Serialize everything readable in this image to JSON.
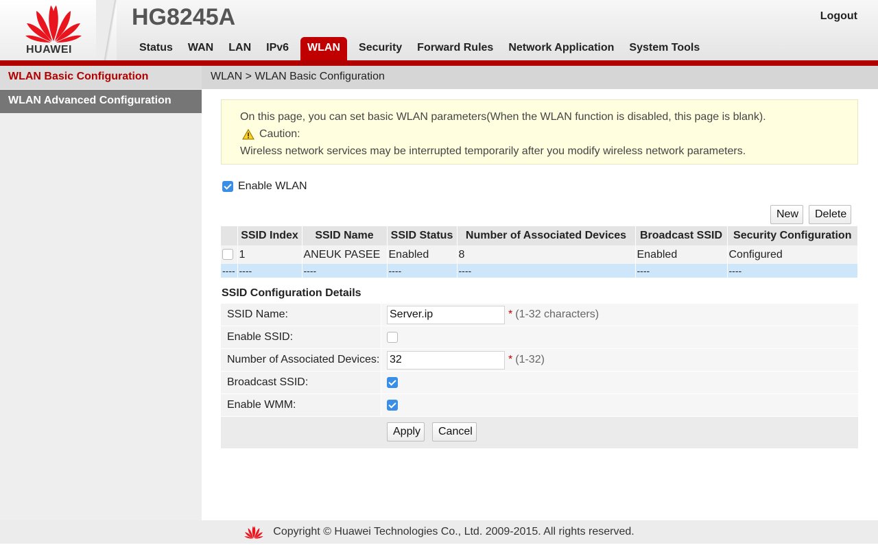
{
  "header": {
    "brand": "HUAWEI",
    "model": "HG8245A",
    "logout": "Logout",
    "nav": [
      "Status",
      "WAN",
      "LAN",
      "IPv6",
      "WLAN",
      "Security",
      "Forward Rules",
      "Network Application",
      "System Tools"
    ],
    "active_nav": "WLAN",
    "brand_color": "#c00000"
  },
  "sidebar": {
    "items": [
      "WLAN Basic Configuration",
      "WLAN Advanced Configuration"
    ],
    "active": "WLAN Basic Configuration"
  },
  "breadcrumb": "WLAN > WLAN Basic Configuration",
  "notice": {
    "line1": "On this page, you can set basic WLAN parameters(When the WLAN function is disabled, this page is blank).",
    "caution_icon": "warning-triangle-icon",
    "caution": "Caution:",
    "line2": "Wireless network services may be interrupted temporarily after you modify wireless network parameters."
  },
  "enable_wlan": {
    "label": "Enable WLAN",
    "checked": true
  },
  "actions": {
    "new": "New",
    "delete": "Delete"
  },
  "ssid_table": {
    "headers": [
      "SSID Index",
      "SSID Name",
      "SSID Status",
      "Number of Associated Devices",
      "Broadcast SSID",
      "Security Configuration"
    ],
    "rows": [
      [
        "1",
        "ANEUK PASEE",
        "Enabled",
        "8",
        "Enabled",
        "Configured"
      ]
    ],
    "empty_row": [
      "----",
      "----",
      "----",
      "----",
      "----",
      "----",
      "----"
    ]
  },
  "details": {
    "title": "SSID Configuration Details",
    "ssid_name_label": "SSID Name:",
    "ssid_name_value": "Server.ip",
    "ssid_name_hint": "(1-32 characters)",
    "required_mark": "*",
    "enable_ssid_label": "Enable SSID:",
    "enable_ssid_checked": false,
    "assoc_label": "Number of Associated Devices:",
    "assoc_value": "32",
    "assoc_hint": "(1-32)",
    "broadcast_label": "Broadcast SSID:",
    "broadcast_checked": true,
    "wmm_label": "Enable WMM:",
    "wmm_checked": true,
    "apply": "Apply",
    "cancel": "Cancel"
  },
  "footer": {
    "copyright": "Copyright © Huawei Technologies Co., Ltd. 2009-2015. All rights reserved.",
    "logo_icon": "huawei-logo-icon"
  }
}
